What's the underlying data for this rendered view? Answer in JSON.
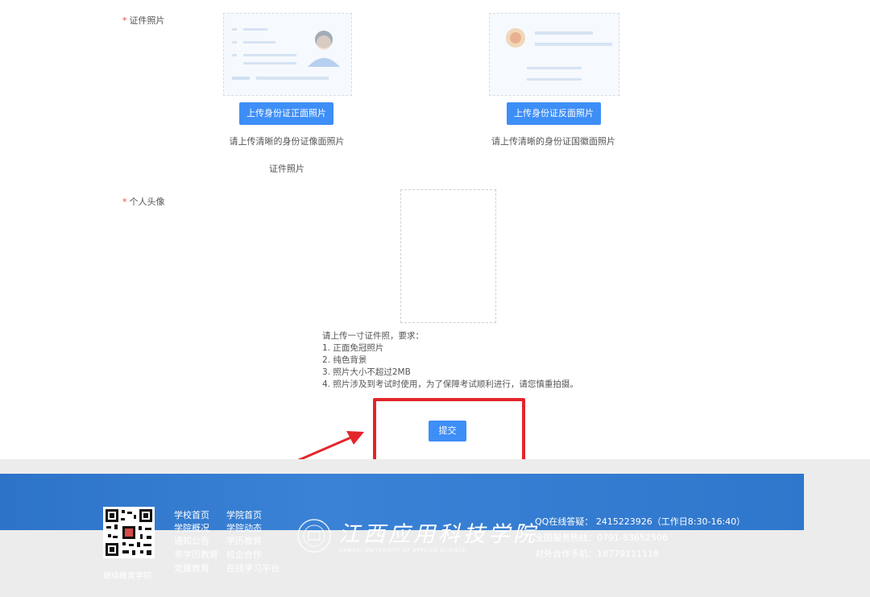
{
  "form": {
    "id_photo_label": "证件照片",
    "front": {
      "button": "上传身份证正面照片",
      "hint": "请上传清晰的身份证像面照片"
    },
    "back": {
      "button": "上传身份证反面照片",
      "hint": "请上传清晰的身份证国徽面照片"
    },
    "id_photo_caption": "证件照片",
    "avatar_label": "个人头像",
    "requirements": [
      "请上传一寸证件照，要求：",
      "1. 正面免冠照片",
      "2. 纯色背景",
      "3. 照片大小不超过2MB",
      "4. 照片涉及到考试时使用，为了保障考试顺利进行，请您慎重拍摄。"
    ],
    "submit": "提交"
  },
  "footer": {
    "qr_caption": "继续教育学院",
    "links_col1": [
      "学校首页",
      "学院概况",
      "通知公告",
      "非学历教育",
      "党建教育"
    ],
    "links_col2": [
      "学院首页",
      "学院动态",
      "学历教育",
      "校企合作",
      "在线学习平台"
    ],
    "logo_cn": "江西应用科技学院",
    "logo_en": "JIANGXI UNIVERSITY OF APPLIED SCIENCE",
    "contact_qq": "QQ在线答疑：  2415223926（工作日8:30-16:40）",
    "contact_phone": "全国服务热线：0791-83652506",
    "contact_coop": "对外合作手机：18779111118"
  },
  "colors": {
    "primary": "#3e8ef7",
    "highlight": "#e3262b",
    "footer_blue": "#2f77cc",
    "footer_gray": "#ececec"
  }
}
